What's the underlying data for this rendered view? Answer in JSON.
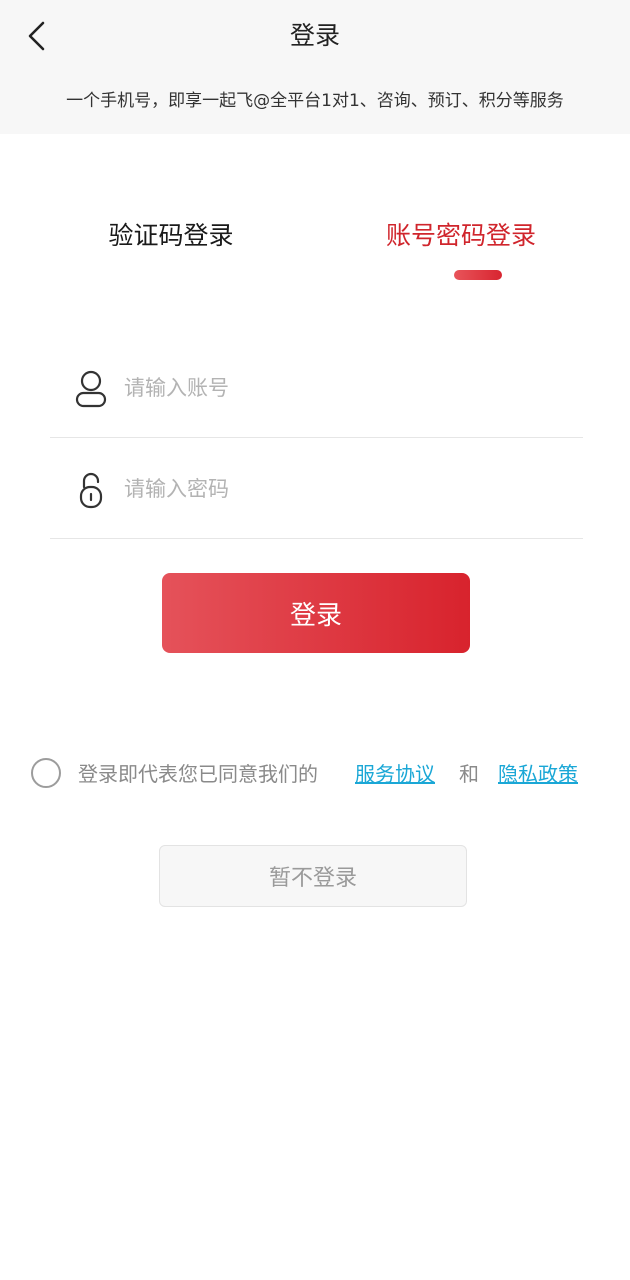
{
  "header": {
    "title": "登录",
    "subtitle": "一个手机号，即享一起飞@全平台1对1、咨询、预订、积分等服务"
  },
  "tabs": {
    "sms_label": "验证码登录",
    "password_label": "账号密码登录",
    "active": "password"
  },
  "form": {
    "account_placeholder": "请输入账号",
    "account_value": "",
    "password_placeholder": "请输入密码",
    "password_value": "",
    "submit_label": "登录"
  },
  "agreement": {
    "checked": false,
    "prefix": "登录即代表您已同意我们的",
    "service_link": "服务协议",
    "and": "和",
    "privacy_link": "隐私政策"
  },
  "skip": {
    "label": "暂不登录"
  },
  "colors": {
    "accent": "#d8232d",
    "link": "#1aa7d6",
    "header_bg": "#f7f7f7"
  },
  "icons": {
    "back": "chevron-left-icon",
    "account": "user-icon",
    "password": "lock-icon",
    "agree": "radio-circle-icon"
  }
}
